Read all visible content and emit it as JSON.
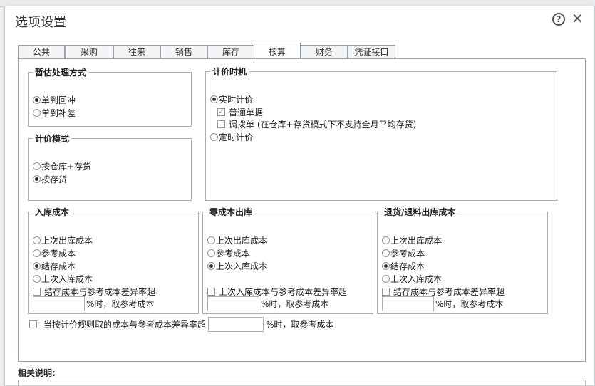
{
  "dialog": {
    "title": "选项设置",
    "help_icon": "?",
    "close_icon": "✕"
  },
  "tabs": [
    "公共",
    "采购",
    "往来",
    "销售",
    "库存",
    "核算",
    "财务",
    "凭证接口"
  ],
  "active_tab": "核算",
  "estimate": {
    "legend": "暂估处理方式",
    "options": [
      "单到回冲",
      "单到补差"
    ],
    "selected": 0
  },
  "pricing_mode": {
    "legend": "计价模式",
    "options": [
      "按仓库+存货",
      "按存货"
    ],
    "selected": 1
  },
  "pricing_time": {
    "legend": "计价时机",
    "realtime": "实时计价",
    "normal_doc": "普通单据",
    "transfer_doc": "调拨单 (在仓库+存货模式下不支持全月平均存货)",
    "scheduled": "定时计价"
  },
  "inbound_cost": {
    "legend": "入库成本",
    "options": [
      "上次出库成本",
      "参考成本",
      "结存成本",
      "上次入库成本"
    ],
    "selected": 2,
    "check_label": "结存成本与参考成本差异率超",
    "suffix": "%时，取参考成本"
  },
  "zero_cost_out": {
    "legend": "零成本出库",
    "options": [
      "上次出库成本",
      "参考成本",
      "上次入库成本"
    ],
    "selected": 2,
    "check_label": "上次入库成本与参考成本差异率超",
    "suffix": "%时，取参考成本"
  },
  "return_cost": {
    "legend": "退货/退料出库成本",
    "options": [
      "上次出库成本",
      "参考成本",
      "结存成本",
      "上次入库成本"
    ],
    "selected": 2,
    "check_label": "结存成本与参考成本差异率超",
    "suffix": "%时，取参考成本"
  },
  "rule_check": {
    "label": "当按计价规则取的成本与参考成本差异率超",
    "suffix": "%时，取参考成本"
  },
  "related": {
    "label": "相关说明:"
  }
}
